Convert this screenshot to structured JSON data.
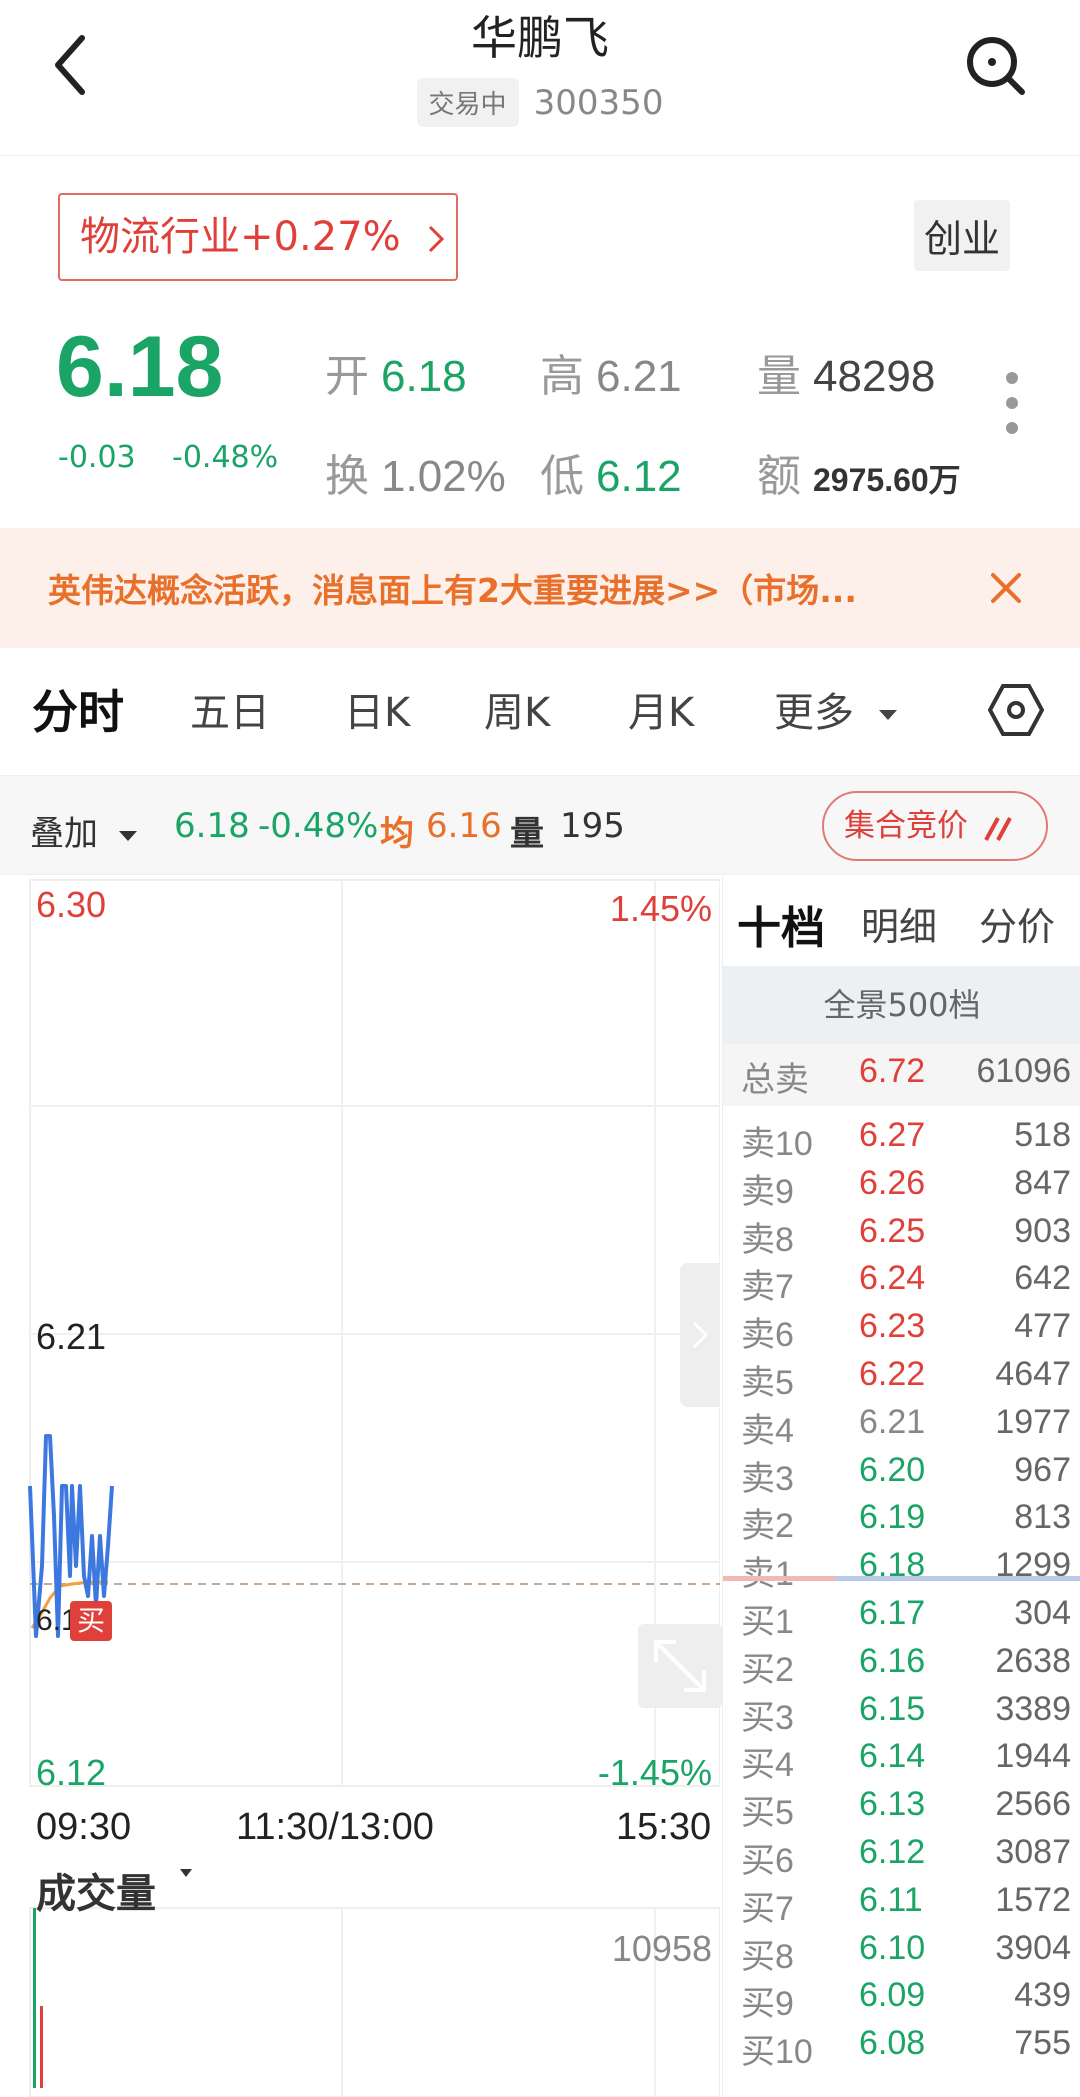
{
  "header": {
    "title": "华鹏飞",
    "status": "交易中",
    "code": "300350"
  },
  "industry": {
    "name": "物流行业",
    "change": "+0.27%",
    "board": "创业"
  },
  "quote": {
    "price": "6.18",
    "change": "-0.03",
    "change_pct": "-0.48%",
    "open_label": "开",
    "open": "6.18",
    "high_label": "高",
    "high": "6.21",
    "volume_label": "量",
    "volume": "48298",
    "turnover_label": "换",
    "turnover": "1.02%",
    "low_label": "低",
    "low": "6.12",
    "amount_label": "额",
    "amount": "2975.60万"
  },
  "banner": {
    "text": "英伟达概念活跃，消息面上有2大重要进展>>（市场..."
  },
  "tabs": [
    "分时",
    "五日",
    "日K",
    "周K",
    "月K",
    "更多"
  ],
  "overlay": {
    "label": "叠加",
    "price": "6.18",
    "pct": "-0.48%",
    "avg_label": "均",
    "avg": "6.16",
    "vol_label": "量",
    "vol": "195",
    "auction": "集合竞价"
  },
  "chart": {
    "y_top": "6.30",
    "y_mid": "6.21",
    "y_bottom": "6.12",
    "pct_top": "1.45%",
    "pct_bottom": "-1.45%",
    "cur_price_partial": "6.1",
    "buy_mark": "买",
    "time_start": "09:30",
    "time_mid": "11:30/13:00",
    "time_end": "15:30",
    "volume_title": "成交量",
    "volume_max": "10958",
    "line_color": "#3d78e0",
    "avg_color": "#f0a040"
  },
  "orderbook": {
    "tabs": [
      "十档",
      "明细",
      "分价"
    ],
    "panorama": "全景500档",
    "total_sell": {
      "label": "总卖",
      "price": "6.72",
      "vol": "61096"
    },
    "sells": [
      {
        "label": "卖10",
        "price": "6.27",
        "vol": "518",
        "color": "red"
      },
      {
        "label": "卖9",
        "price": "6.26",
        "vol": "847",
        "color": "red"
      },
      {
        "label": "卖8",
        "price": "6.25",
        "vol": "903",
        "color": "red"
      },
      {
        "label": "卖7",
        "price": "6.24",
        "vol": "642",
        "color": "red"
      },
      {
        "label": "卖6",
        "price": "6.23",
        "vol": "477",
        "color": "red"
      },
      {
        "label": "卖5",
        "price": "6.22",
        "vol": "4647",
        "color": "red"
      },
      {
        "label": "卖4",
        "price": "6.21",
        "vol": "1977",
        "color": "gray"
      },
      {
        "label": "卖3",
        "price": "6.20",
        "vol": "967",
        "color": "green"
      },
      {
        "label": "卖2",
        "price": "6.19",
        "vol": "813",
        "color": "green"
      },
      {
        "label": "卖1",
        "price": "6.18",
        "vol": "1299",
        "color": "green"
      }
    ],
    "buys": [
      {
        "label": "买1",
        "price": "6.17",
        "vol": "304",
        "color": "green"
      },
      {
        "label": "买2",
        "price": "6.16",
        "vol": "2638",
        "color": "green"
      },
      {
        "label": "买3",
        "price": "6.15",
        "vol": "3389",
        "color": "green"
      },
      {
        "label": "买4",
        "price": "6.14",
        "vol": "1944",
        "color": "green"
      },
      {
        "label": "买5",
        "price": "6.13",
        "vol": "2566",
        "color": "green"
      },
      {
        "label": "买6",
        "price": "6.12",
        "vol": "3087",
        "color": "green"
      },
      {
        "label": "买7",
        "price": "6.11",
        "vol": "1572",
        "color": "green"
      },
      {
        "label": "买8",
        "price": "6.10",
        "vol": "3904",
        "color": "green"
      },
      {
        "label": "买9",
        "price": "6.09",
        "vol": "439",
        "color": "green"
      },
      {
        "label": "买10",
        "price": "6.08",
        "vol": "755",
        "color": "green"
      }
    ]
  }
}
